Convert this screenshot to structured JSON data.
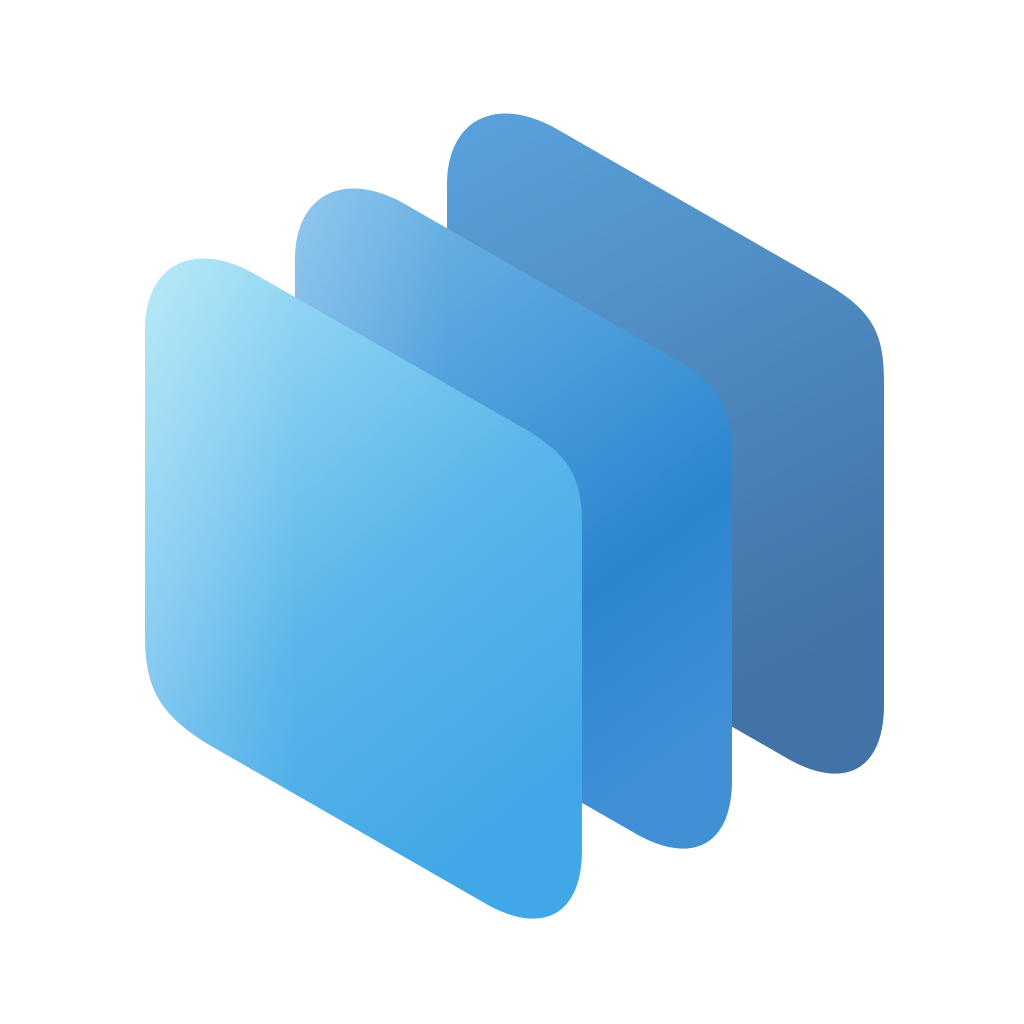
{
  "logo": {
    "icon": "stacked-layers-icon",
    "colors": {
      "background": "#ffffff",
      "back_layer_top": "#5aa2dc",
      "back_layer_bottom": "#4372a6",
      "middle_layer_top": "#75b9e8",
      "middle_layer_mid": "#2b86cf",
      "middle_layer_bottom": "#4190d6",
      "front_layer_top": "#a9e4f6",
      "front_layer_mid": "#5ab5ea",
      "front_layer_bottom": "#42a7e6"
    }
  }
}
